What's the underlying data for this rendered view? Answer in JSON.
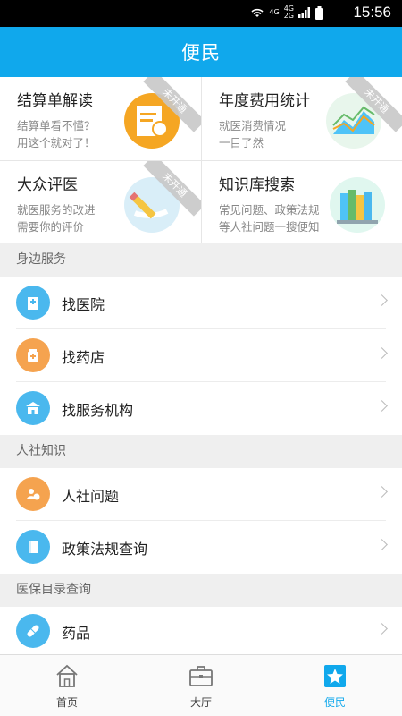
{
  "status_bar": {
    "time": "15:56",
    "net_top": "4G",
    "net_mid": "4G",
    "net_bot": "2G"
  },
  "header": {
    "title": "便民"
  },
  "tiles": [
    {
      "title": "结算单解读",
      "desc1": "结算单看不懂？",
      "desc2": "用这个就对了！",
      "ribbon": "未开通",
      "icon": "receipt-icon",
      "color": "#f5a623"
    },
    {
      "title": "年度费用统计",
      "desc1": "就医消费情况",
      "desc2": "一目了然",
      "ribbon": "未开通",
      "icon": "chart-icon",
      "color": "#4fc3f7"
    },
    {
      "title": "大众评医",
      "desc1": "就医服务的改进",
      "desc2": "需要你的评价",
      "ribbon": "未开通",
      "icon": "pen-icon",
      "color": "#4fc3f7"
    },
    {
      "title": "知识库搜索",
      "desc1": "常见问题、政策法规",
      "desc2": "等人社问题一搜便知",
      "icon": "books-icon",
      "color": "#e0f7ef"
    }
  ],
  "sections": [
    {
      "title": "身边服务"
    },
    {
      "title": "人社知识"
    },
    {
      "title": "医保目录查询"
    }
  ],
  "rows": [
    {
      "label": "找医院",
      "icon": "hospital-icon",
      "color": "#4ab8ee"
    },
    {
      "label": "找药店",
      "icon": "pharmacy-icon",
      "color": "#f5a34f"
    },
    {
      "label": "找服务机构",
      "icon": "building-icon",
      "color": "#4ab8ee"
    },
    {
      "label": "人社问题",
      "icon": "question-people-icon",
      "color": "#f5a34f"
    },
    {
      "label": "政策法规查询",
      "icon": "document-icon",
      "color": "#4ab8ee"
    },
    {
      "label": "药品",
      "icon": "pill-icon",
      "color": "#4ab8ee"
    }
  ],
  "nav": [
    {
      "label": "首页",
      "icon": "home-icon"
    },
    {
      "label": "大厅",
      "icon": "briefcase-icon"
    },
    {
      "label": "便民",
      "icon": "star-icon",
      "active": true
    }
  ],
  "colors": {
    "accent": "#10a8ec",
    "orange": "#f5a34f"
  }
}
